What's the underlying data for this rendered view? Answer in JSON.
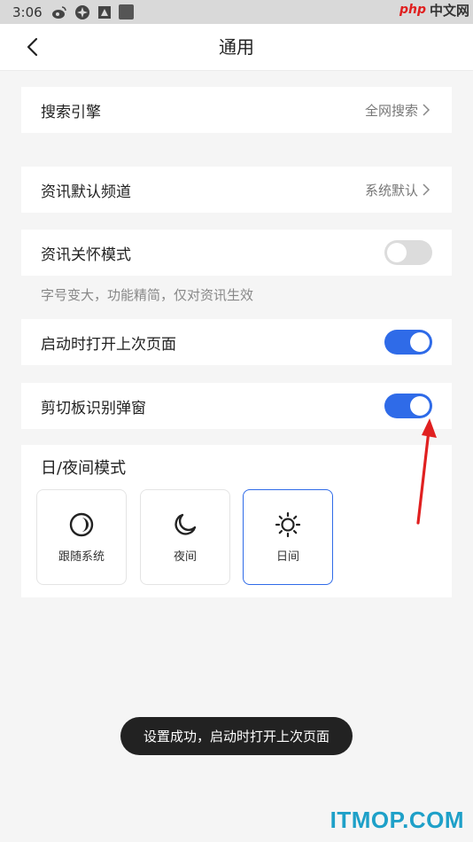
{
  "status_bar": {
    "time": "3:06",
    "icons": [
      "weibo-icon",
      "browser-icon",
      "image-icon",
      "square-icon"
    ]
  },
  "watermark_top": {
    "brand": "php",
    "text": "中文网"
  },
  "header": {
    "title": "通用",
    "back_icon": "chevron-left-icon"
  },
  "settings": {
    "search_engine": {
      "label": "搜索引擎",
      "value": "全网搜索"
    },
    "news_channel": {
      "label": "资讯默认频道",
      "value": "系统默认"
    },
    "care_mode": {
      "label": "资讯关怀模式",
      "enabled": false,
      "hint": "字号变大，功能精简，仅对资讯生效"
    },
    "restore_last_page": {
      "label": "启动时打开上次页面",
      "enabled": true
    },
    "clipboard_popup": {
      "label": "剪切板识别弹窗",
      "enabled": true
    }
  },
  "theme": {
    "title": "日/夜间模式",
    "options": [
      {
        "label": "跟随系统",
        "icon": "half-circle-icon",
        "selected": false
      },
      {
        "label": "夜间",
        "icon": "moon-icon",
        "selected": false
      },
      {
        "label": "日间",
        "icon": "sun-icon",
        "selected": true
      }
    ]
  },
  "toast": {
    "text": "设置成功，启动时打开上次页面"
  },
  "watermark_bottom": {
    "text": "ITMOP.COM"
  },
  "colors": {
    "accent": "#2f6be8",
    "annotation_arrow": "#e02020",
    "watermark_bottom": "#1ea0c8"
  }
}
